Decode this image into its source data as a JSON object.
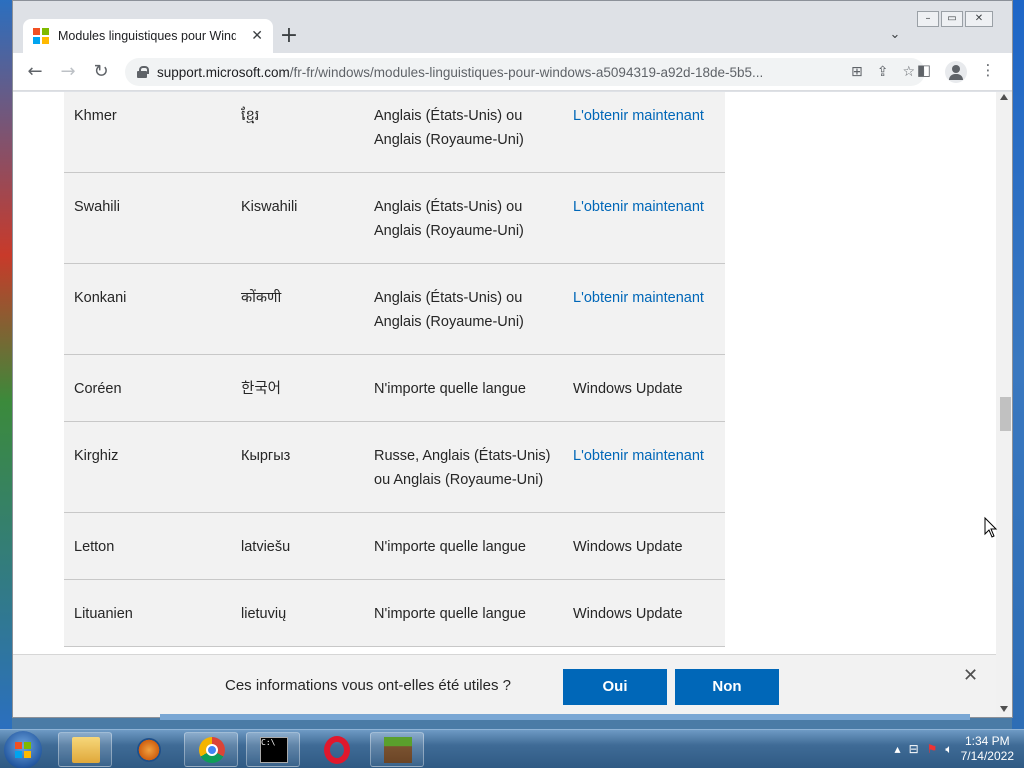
{
  "browser": {
    "tab_title": "Modules linguistiques pour Windows",
    "url_host": "support.microsoft.com",
    "url_path": "/fr-fr/windows/modules-linguistiques-pour-windows-a5094319-a92d-18de-5b5..."
  },
  "table": {
    "rows": [
      {
        "language": "Khmer",
        "native": "ខ្មែរ",
        "prereq": "Anglais (États-Unis) ou Anglais (Royaume-Uni)",
        "action": "L'obtenir maintenant",
        "is_link": true
      },
      {
        "language": "Swahili",
        "native": "Kiswahili",
        "prereq": "Anglais (États-Unis) ou Anglais (Royaume-Uni)",
        "action": "L'obtenir maintenant",
        "is_link": true
      },
      {
        "language": "Konkani",
        "native": "कोंकणी",
        "prereq": "Anglais (États-Unis) ou Anglais (Royaume-Uni)",
        "action": "L'obtenir maintenant",
        "is_link": true
      },
      {
        "language": "Coréen",
        "native": "한국어",
        "prereq": "N'importe quelle langue",
        "action": "Windows Update",
        "is_link": false
      },
      {
        "language": "Kirghiz",
        "native": "Кыргыз",
        "prereq": "Russe, Anglais (États-Unis) ou Anglais (Royaume-Uni)",
        "action": "L'obtenir maintenant",
        "is_link": true
      },
      {
        "language": "Letton",
        "native": "latviešu",
        "prereq": "N'importe quelle langue",
        "action": "Windows Update",
        "is_link": false
      },
      {
        "language": "Lituanien",
        "native": "lietuvių",
        "prereq": "N'importe quelle langue",
        "action": "Windows Update",
        "is_link": false
      }
    ]
  },
  "feedback": {
    "question": "Ces informations vous ont-elles été utiles ?",
    "yes_label": "Oui",
    "no_label": "Non"
  },
  "taskbar": {
    "time": "1:34 PM",
    "date": "7/14/2022"
  },
  "colors": {
    "link": "#0067b8",
    "button": "#0067b8",
    "row_bg": "#f2f2f2"
  }
}
